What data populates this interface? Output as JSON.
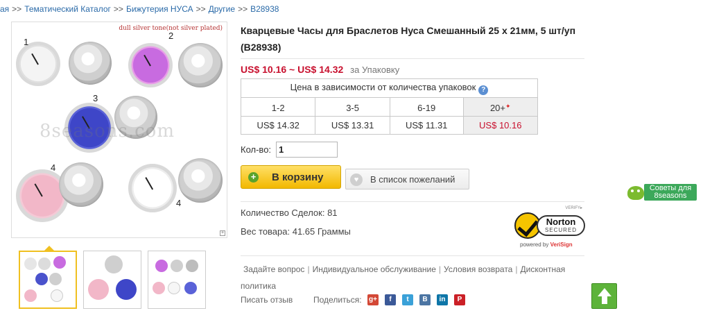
{
  "breadcrumb": [
    "ая",
    "Тематический Каталог",
    "Бижутерия НУСА",
    "Другие",
    "B28938"
  ],
  "breadcrumb_sep": ">>",
  "image": {
    "banner": "dull silver tone(not silver plated)",
    "watermark": "8seasons.com",
    "labels": [
      "1",
      "2",
      "3",
      "4",
      "4"
    ]
  },
  "product": {
    "title": "Кварцевые Часы для Браслетов Нуса Смешанный 25 x 21мм, 5 шт/уп  (B28938)",
    "price_range": "US$ 10.16 ~ US$ 14.32",
    "price_unit": "за Упаковку"
  },
  "tiers": {
    "header": "Цена в зависимости от количества упаковок",
    "help_icon": "?",
    "quantities": [
      "1-2",
      "3-5",
      "6-19",
      "20+"
    ],
    "prices": [
      "US$ 14.32",
      "US$ 13.31",
      "US$ 11.31",
      "US$ 10.16"
    ]
  },
  "quantity": {
    "label": "Кол-во:",
    "value": "1"
  },
  "buttons": {
    "cart": "В корзину",
    "wishlist": "В список пожеланий"
  },
  "stats": {
    "deals": "Количество Сделок: 81",
    "weight": "Вес товара: 41.65 Граммы"
  },
  "norton": {
    "verify": "VERIFY▸",
    "brand": "Norton",
    "secured": "SECURED",
    "powered_prefix": "powered by ",
    "powered_brand": "VeriSign"
  },
  "links": {
    "ask": "Задайте вопрос",
    "service": "Индивидуальное обслуживание",
    "returns": "Условия возврата",
    "discount": "Дисконтная политика",
    "separator": "|"
  },
  "review": "Писать отзыв",
  "share": {
    "label": "Поделиться:",
    "networks": [
      "g+",
      "f",
      "t",
      "B",
      "in",
      "P"
    ]
  },
  "tips": {
    "line1": "Советы для",
    "line2": "8seasons"
  },
  "colors": {
    "price_red": "#c8102e",
    "link_blue": "#2a6aa8",
    "cart_yellow": "#f2b800",
    "green": "#5db33a"
  }
}
